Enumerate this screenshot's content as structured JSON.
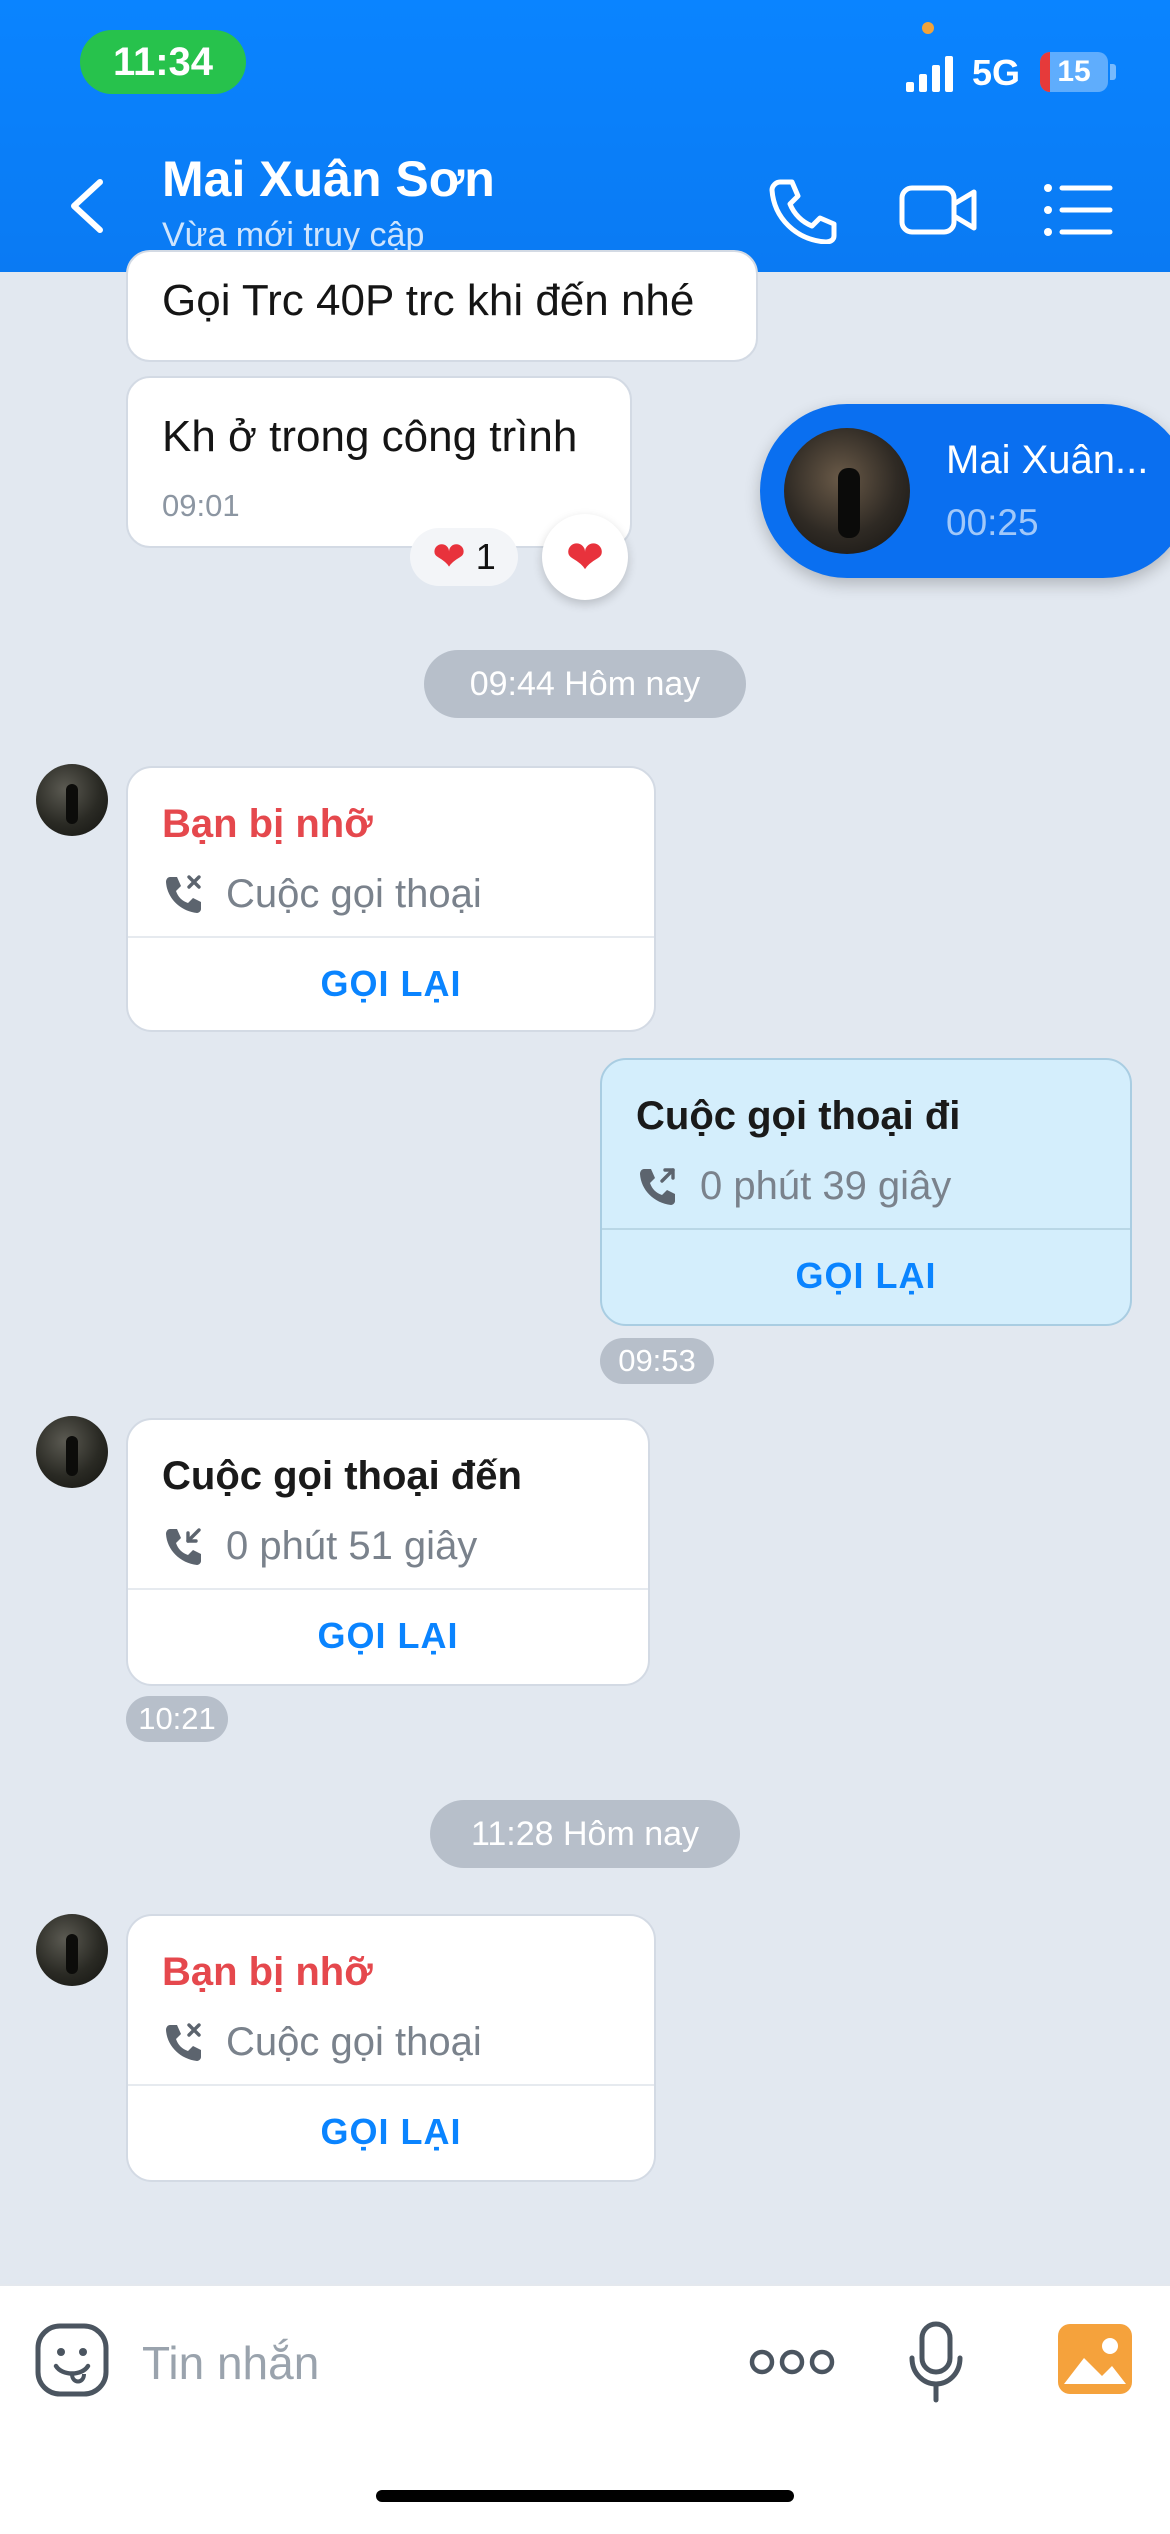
{
  "status_bar": {
    "time": "11:34",
    "network": "5G",
    "battery": "15",
    "battery_level": 0.15
  },
  "header": {
    "contact_name": "Mai Xuân Sơn",
    "status": "Vừa mới truy cập",
    "icons": [
      "back-icon",
      "phone-icon",
      "video-icon",
      "menu-icon"
    ]
  },
  "messages": {
    "partial": {
      "text": "Gọi Trc 40P trc khi đến nhé"
    },
    "site": {
      "text": "Kh ở trong công trình",
      "time": "09:01"
    },
    "reaction": {
      "emoji": "❤️",
      "count": "1"
    }
  },
  "dates": {
    "first": "09:44 Hôm nay",
    "second": "11:28 Hôm nay"
  },
  "calls": [
    {
      "type": "missed",
      "title": "Bạn bị nhỡ",
      "subtitle": "Cuộc gọi thoại",
      "action": "GỌI LẠI"
    },
    {
      "type": "outgoing",
      "title": "Cuộc gọi thoại đi",
      "subtitle": "0 phút 39 giây",
      "action": "GỌI LẠI",
      "time": "09:53"
    },
    {
      "type": "incoming",
      "title": "Cuộc gọi thoại đến",
      "subtitle": "0 phút 51 giây",
      "action": "GỌI LẠI",
      "time": "10:21"
    },
    {
      "type": "missed",
      "title": "Bạn bị nhỡ",
      "subtitle": "Cuộc gọi thoại",
      "action": "GỌI LẠI"
    }
  ],
  "floating_call": {
    "name": "Mai Xuân...",
    "duration": "00:25"
  },
  "input": {
    "placeholder": "Tin nhắn"
  },
  "colors": {
    "header_blue": "#0a84ff",
    "missed_red": "#e5484d",
    "action_blue": "#0a84ff",
    "outgoing_bg": "#d4eefc",
    "status_green": "#27c24c"
  }
}
